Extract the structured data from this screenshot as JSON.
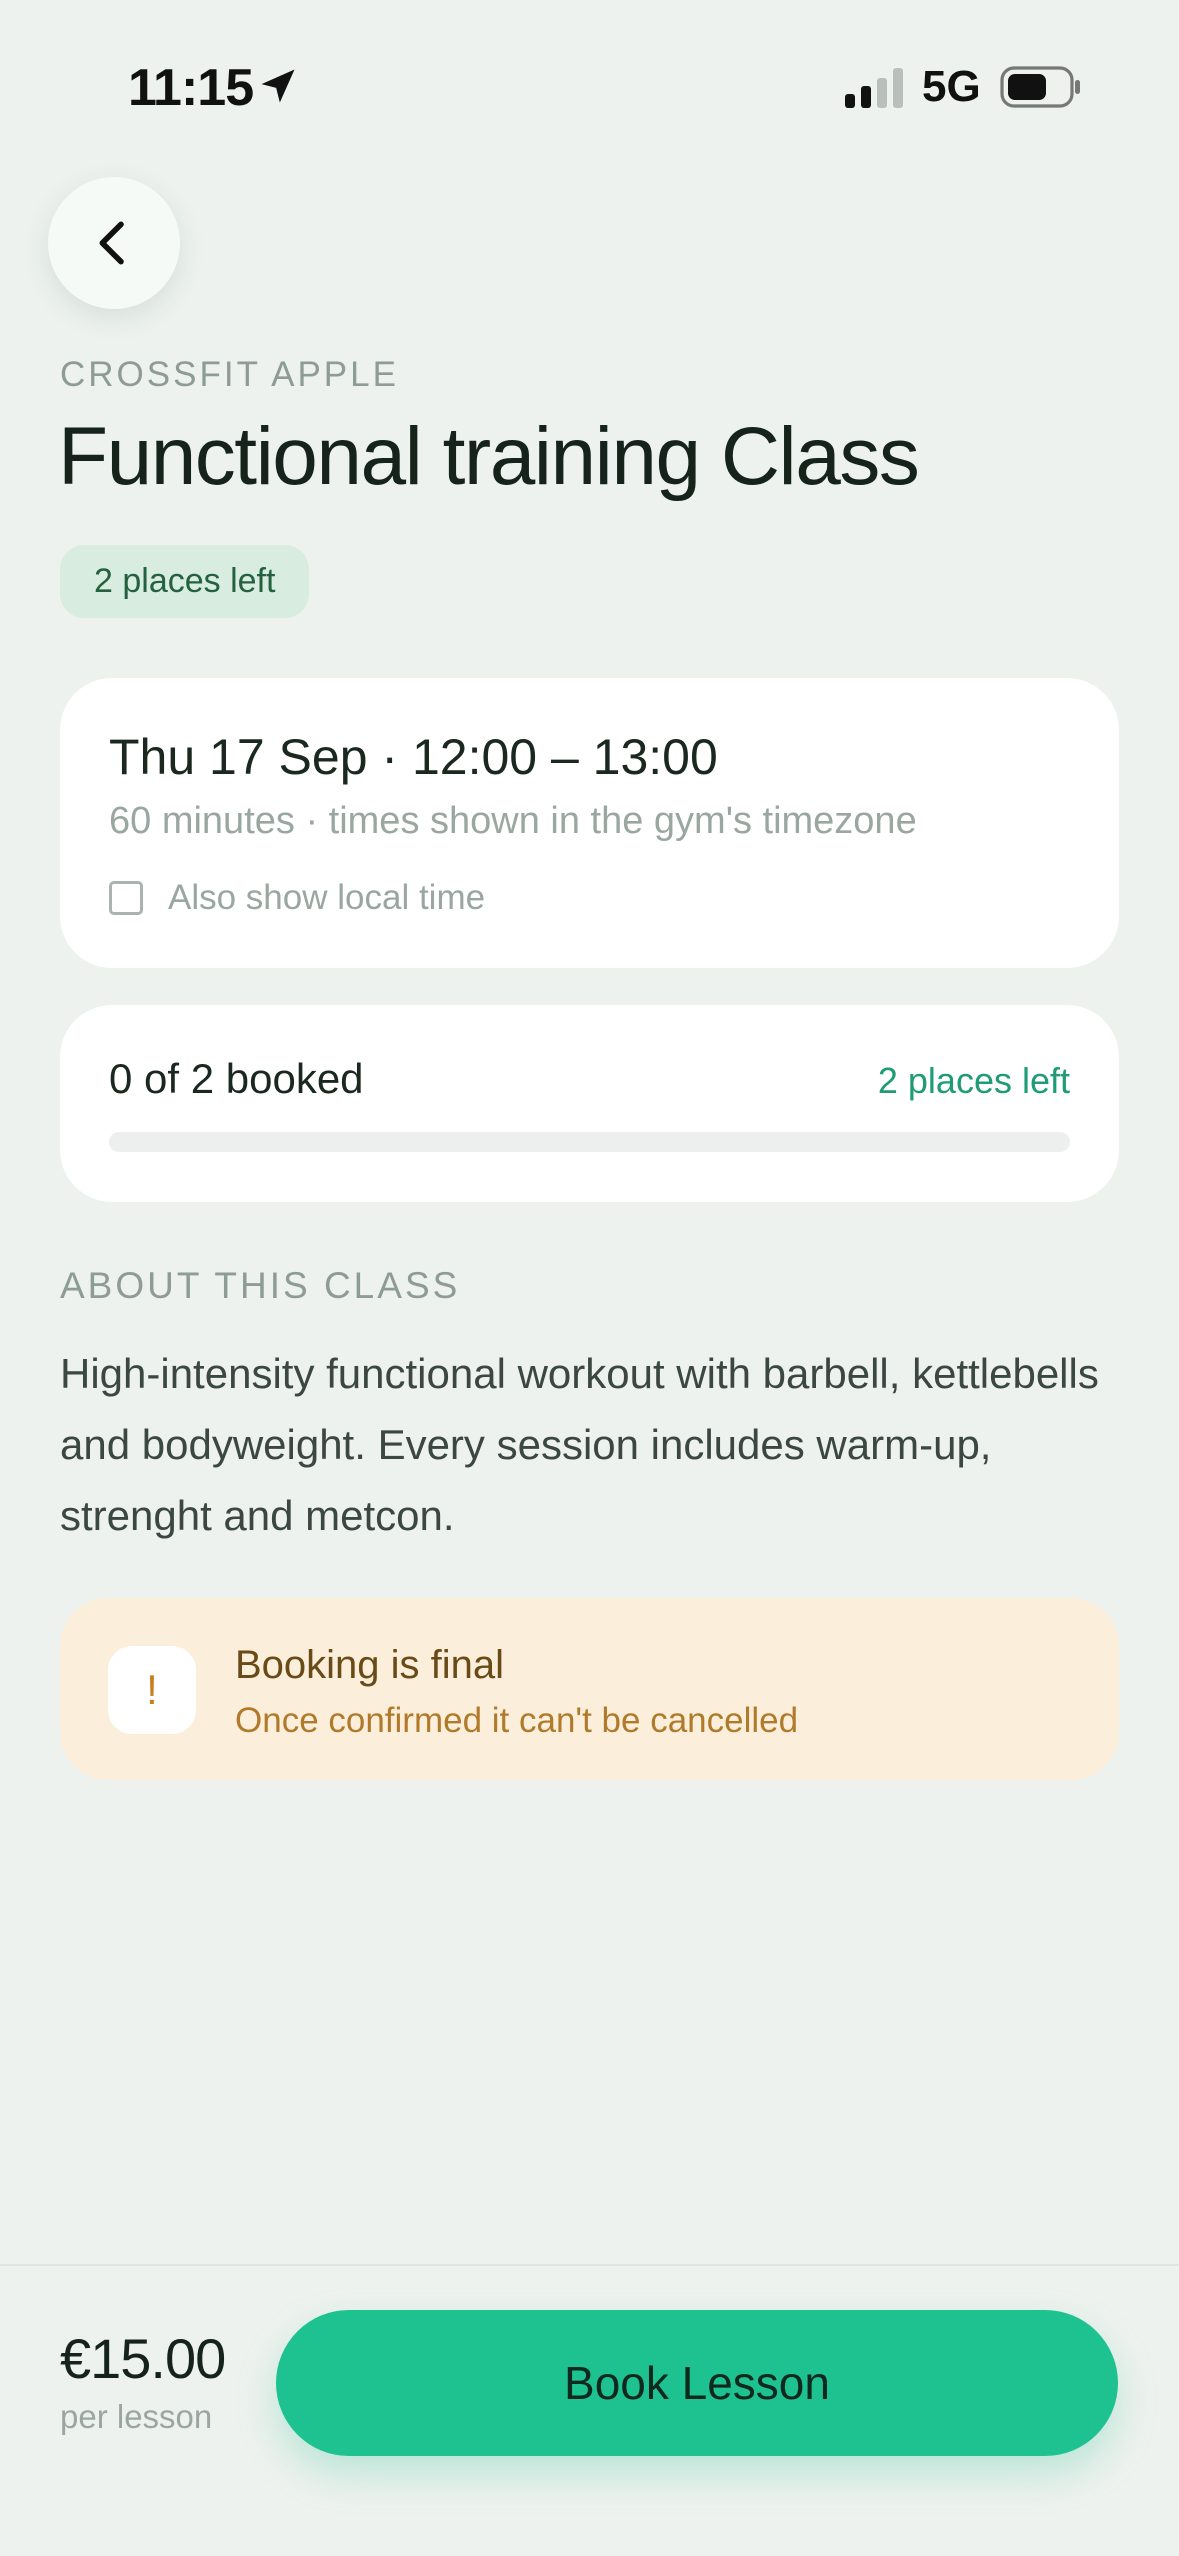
{
  "status_bar": {
    "time": "11:15",
    "network": "5G"
  },
  "header": {
    "gym_name": "CROSSFIT APPLE",
    "title": "Functional training Class",
    "places_badge": "2 places left"
  },
  "schedule_card": {
    "datetime": "Thu 17 Sep · 12:00 – 13:00",
    "subtitle": "60 minutes · times shown in the gym's timezone",
    "local_time_label": "Also show local time",
    "local_time_checked": false
  },
  "booking_card": {
    "count_label": "0 of 2 booked",
    "places_left": "2 places left",
    "booked_fraction": 0
  },
  "about": {
    "heading": "ABOUT THIS CLASS",
    "text": "High-intensity functional workout with barbell, kettlebells and bodyweight. Every session includes warm-up, strenght and metcon."
  },
  "notice": {
    "icon_glyph": "!",
    "title": "Booking is final",
    "subtitle": "Once confirmed it can't be cancelled"
  },
  "footer": {
    "price": "€15.00",
    "price_unit": "per lesson",
    "book_label": "Book Lesson"
  },
  "colors": {
    "accent": "#1ec190",
    "background": "#edf2ee",
    "notice_bg": "#fbefdc"
  }
}
